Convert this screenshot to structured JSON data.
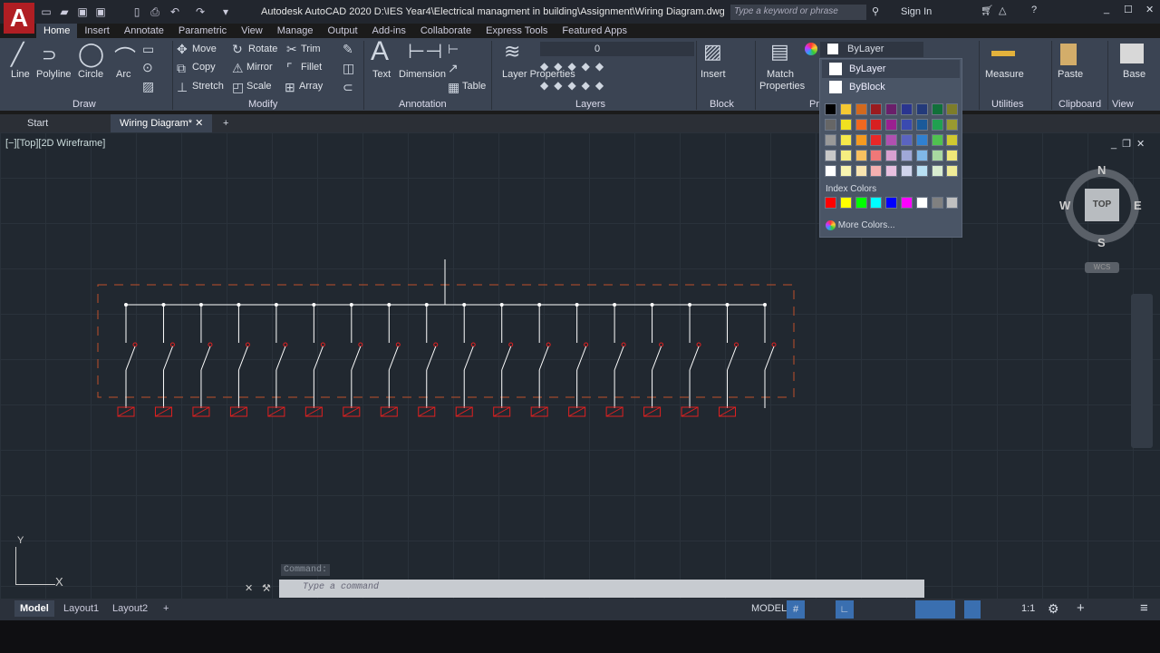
{
  "window": {
    "title": "Autodesk AutoCAD 2020   D:\\IES Year4\\Electrical managment in building\\Assignment\\Wiring Diagram.dwg",
    "search_placeholder": "Type a keyword or phrase",
    "sign_in": "Sign In"
  },
  "ribbon_tabs": [
    "Home",
    "Insert",
    "Annotate",
    "Parametric",
    "View",
    "Manage",
    "Output",
    "Add-ins",
    "Collaborate",
    "Express Tools",
    "Featured Apps"
  ],
  "draw": {
    "line": "Line",
    "polyline": "Polyline",
    "circle": "Circle",
    "arc": "Arc",
    "title": "Draw"
  },
  "modify": {
    "move": "Move",
    "rotate": "Rotate",
    "trim": "Trim",
    "copy": "Copy",
    "mirror": "Mirror",
    "fillet": "Fillet",
    "stretch": "Stretch",
    "scale": "Scale",
    "array": "Array",
    "title": "Modify"
  },
  "annotation": {
    "text": "Text",
    "dimension": "Dimension",
    "table": "Table",
    "title": "Annotation"
  },
  "layers": {
    "layer_properties": "Layer Properties",
    "current_layer": "0",
    "title": "Layers"
  },
  "block": {
    "insert": "Insert",
    "title": "Block"
  },
  "properties": {
    "match": "Match Properties",
    "color_value": "ByLayer",
    "title": "Pr"
  },
  "utilities": {
    "measure": "Measure",
    "title": "Utilities"
  },
  "clipboard": {
    "paste": "Paste",
    "title": "Clipboard"
  },
  "view": {
    "base": "Base",
    "title": "View"
  },
  "doc_tabs": {
    "start": "Start",
    "active": "Wiring Diagram*"
  },
  "viewport_label": "[−][Top][2D Wireframe]",
  "color_dropdown": {
    "bylayer": "ByLayer",
    "byblock": "ByBlock",
    "palette": [
      [
        "#000000",
        "#f5c932",
        "#d2691e",
        "#9b1b1f",
        "#6a1f6a",
        "#2a3590",
        "#233a7a",
        "#11703a",
        "#7d7d2a"
      ],
      [
        "#666666",
        "#f0e020",
        "#f06820",
        "#d82020",
        "#9a2090",
        "#3a4ab0",
        "#1a5a9a",
        "#20a050",
        "#9a9a30"
      ],
      [
        "#999999",
        "#f5e84a",
        "#f59a20",
        "#e82828",
        "#b050b0",
        "#5a64c0",
        "#3080d0",
        "#50c050",
        "#d0c830"
      ],
      [
        "#c8c8c8",
        "#f5ee80",
        "#f8c060",
        "#f07878",
        "#d8a0d0",
        "#a0a8d8",
        "#80b8e8",
        "#a8d8a0",
        "#f0e878"
      ],
      [
        "#ffffff",
        "#f8f4b0",
        "#f8e4b0",
        "#f4b0b0",
        "#e8c0e0",
        "#d0d4ec",
        "#b8e0f4",
        "#d8ecd0",
        "#f0ec98"
      ]
    ],
    "index_label": "Index Colors",
    "index_colors": [
      "#ff0000",
      "#ffff00",
      "#00ff00",
      "#00ffff",
      "#0000ff",
      "#ff00ff",
      "#ffffff",
      "#808080",
      "#c0c0c0"
    ],
    "more": "More Colors..."
  },
  "viewcube": {
    "n": "N",
    "s": "S",
    "e": "E",
    "w": "W",
    "top": "TOP",
    "wcs": "WCS"
  },
  "ucs": {
    "x": "X",
    "y": "Y"
  },
  "command": {
    "history": "Command:",
    "placeholder": "Type a command"
  },
  "layout_tabs": [
    "Model",
    "Layout1",
    "Layout2"
  ],
  "status": {
    "model": "MODEL",
    "scale": "1:1"
  },
  "drawing_colors": {
    "wire": "#ffffff",
    "box": "#e02020",
    "boundary": "#c0502a"
  }
}
